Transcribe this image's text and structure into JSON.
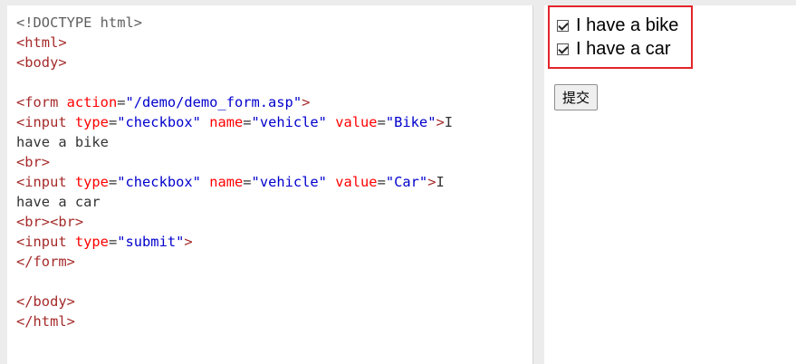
{
  "editor": {
    "lines": [
      [
        {
          "t": "doctype",
          "s": "<!DOCTYPE html>"
        }
      ],
      [
        {
          "t": "tag",
          "s": "<html>"
        }
      ],
      [
        {
          "t": "tag",
          "s": "<body>"
        }
      ],
      [],
      [
        {
          "t": "tag",
          "s": "<form "
        },
        {
          "t": "attr",
          "s": "action"
        },
        {
          "t": "plain",
          "s": "="
        },
        {
          "t": "val",
          "s": "\"/demo/demo_form.asp\""
        },
        {
          "t": "tag",
          "s": ">"
        }
      ],
      [
        {
          "t": "tag",
          "s": "<input "
        },
        {
          "t": "attr",
          "s": "type"
        },
        {
          "t": "plain",
          "s": "="
        },
        {
          "t": "val",
          "s": "\"checkbox\""
        },
        {
          "t": "plain",
          "s": " "
        },
        {
          "t": "attr",
          "s": "name"
        },
        {
          "t": "plain",
          "s": "="
        },
        {
          "t": "val",
          "s": "\"vehicle\""
        },
        {
          "t": "plain",
          "s": " "
        },
        {
          "t": "attr",
          "s": "value"
        },
        {
          "t": "plain",
          "s": "="
        },
        {
          "t": "val",
          "s": "\"Bike\""
        },
        {
          "t": "tag",
          "s": ">"
        },
        {
          "t": "plain",
          "s": "I"
        }
      ],
      [
        {
          "t": "plain",
          "s": "have a bike"
        }
      ],
      [
        {
          "t": "tag",
          "s": "<br>"
        }
      ],
      [
        {
          "t": "tag",
          "s": "<input "
        },
        {
          "t": "attr",
          "s": "type"
        },
        {
          "t": "plain",
          "s": "="
        },
        {
          "t": "val",
          "s": "\"checkbox\""
        },
        {
          "t": "plain",
          "s": " "
        },
        {
          "t": "attr",
          "s": "name"
        },
        {
          "t": "plain",
          "s": "="
        },
        {
          "t": "val",
          "s": "\"vehicle\""
        },
        {
          "t": "plain",
          "s": " "
        },
        {
          "t": "attr",
          "s": "value"
        },
        {
          "t": "plain",
          "s": "="
        },
        {
          "t": "val",
          "s": "\"Car\""
        },
        {
          "t": "tag",
          "s": ">"
        },
        {
          "t": "plain",
          "s": "I"
        }
      ],
      [
        {
          "t": "plain",
          "s": "have a car"
        }
      ],
      [
        {
          "t": "tag",
          "s": "<br><br>"
        }
      ],
      [
        {
          "t": "tag",
          "s": "<input "
        },
        {
          "t": "attr",
          "s": "type"
        },
        {
          "t": "plain",
          "s": "="
        },
        {
          "t": "val",
          "s": "\"submit\""
        },
        {
          "t": "tag",
          "s": ">"
        }
      ],
      [
        {
          "t": "tag",
          "s": "</form>"
        }
      ],
      [],
      [
        {
          "t": "tag",
          "s": "</body>"
        }
      ],
      [
        {
          "t": "tag",
          "s": "</html>"
        }
      ]
    ]
  },
  "preview": {
    "checkbox_bike": {
      "label": "I have a bike",
      "checked": true
    },
    "checkbox_car": {
      "label": "I have a car",
      "checked": true
    },
    "submit_label": "提交",
    "highlight_color": "#e3242b"
  },
  "colors": {
    "tag": "#a52a2a",
    "attr": "#ff0000",
    "value": "#0000cd",
    "text": "#333333"
  }
}
